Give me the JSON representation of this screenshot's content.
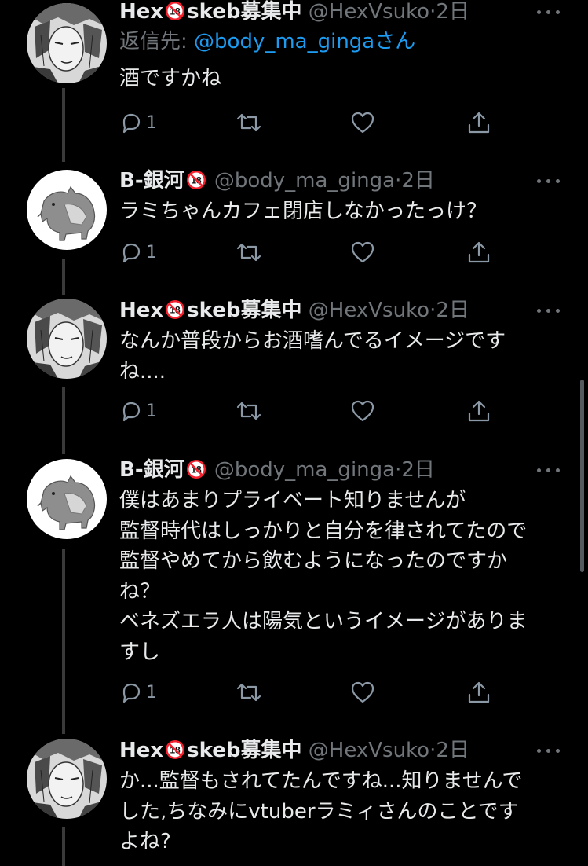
{
  "tweets": [
    {
      "author": "hex",
      "name": "Hex",
      "badge": "18",
      "name_suffix": "skeb募集中",
      "handle": "@HexVsuko",
      "dot": "·",
      "time": "2日",
      "reply_label": "返信先: ",
      "reply_handle": "@body_ma_ginga",
      "reply_suffix": "さん",
      "text": "酒ですかね",
      "replies": "1"
    },
    {
      "author": "ginga",
      "name": "B-銀河",
      "badge": "18",
      "handle": "@body_ma_ginga",
      "dot": "·",
      "time": "2日",
      "text": "ラミちゃんカフェ閉店しなかったっけ？",
      "replies": "1"
    },
    {
      "author": "hex",
      "name": "Hex",
      "badge": "18",
      "name_suffix": "skeb募集中",
      "handle": "@HexVsuko",
      "dot": "·",
      "time": "2日",
      "text": "なんか普段からお酒嗜んでるイメージです\nね....",
      "replies": "1"
    },
    {
      "author": "ginga",
      "name": "B-銀河",
      "badge": "18",
      "handle": "@body_ma_ginga",
      "dot": "·",
      "time": "2日",
      "text": "僕はあまりプライベート知りませんが\n監督時代はしっかりと自分を律されてたので\n監督やめてから飲むようになったのですか\nね？\nベネズエラ人は陽気というイメージがありま\nすし",
      "replies": "1"
    },
    {
      "author": "hex",
      "name": "Hex",
      "badge": "18",
      "name_suffix": "skeb募集中",
      "handle": "@HexVsuko",
      "dot": "·",
      "time": "2日",
      "text": "か...監督もされてたんですね...知りませんで\nした,ちなみにvtuberラミィさんのことです\nよね?"
    }
  ],
  "icons": {
    "reply": "reply-icon",
    "retweet": "retweet-icon",
    "like": "heart-icon",
    "share": "share-icon",
    "more": "more-icon",
    "badge": "r18-icon"
  },
  "colors": {
    "background": "#000000",
    "text": "#e7e9ea",
    "secondary": "#71767b",
    "link": "#1d9bf0",
    "badge": "#f4212e",
    "thread_line": "#3a3a3a"
  }
}
